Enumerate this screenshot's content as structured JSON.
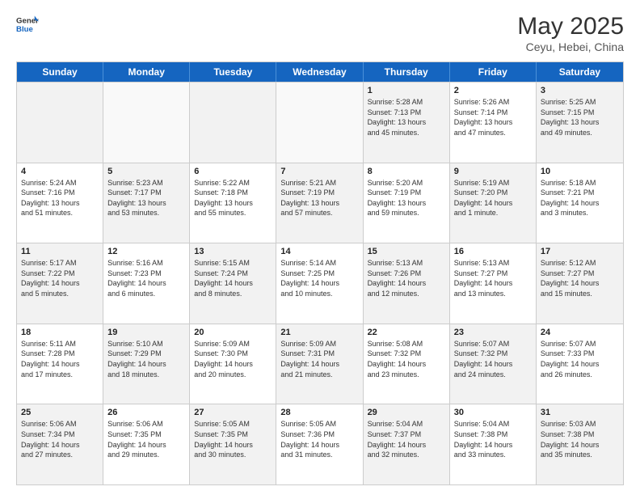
{
  "header": {
    "logo_general": "General",
    "logo_blue": "Blue",
    "title": "May 2025",
    "subtitle": "Ceyu, Hebei, China"
  },
  "days_of_week": [
    "Sunday",
    "Monday",
    "Tuesday",
    "Wednesday",
    "Thursday",
    "Friday",
    "Saturday"
  ],
  "weeks": [
    [
      {
        "day": "",
        "text": "",
        "shaded": true
      },
      {
        "day": "",
        "text": "",
        "shaded": false
      },
      {
        "day": "",
        "text": "",
        "shaded": true
      },
      {
        "day": "",
        "text": "",
        "shaded": false
      },
      {
        "day": "1",
        "text": "Sunrise: 5:28 AM\nSunset: 7:13 PM\nDaylight: 13 hours\nand 45 minutes.",
        "shaded": true
      },
      {
        "day": "2",
        "text": "Sunrise: 5:26 AM\nSunset: 7:14 PM\nDaylight: 13 hours\nand 47 minutes.",
        "shaded": false
      },
      {
        "day": "3",
        "text": "Sunrise: 5:25 AM\nSunset: 7:15 PM\nDaylight: 13 hours\nand 49 minutes.",
        "shaded": true
      }
    ],
    [
      {
        "day": "4",
        "text": "Sunrise: 5:24 AM\nSunset: 7:16 PM\nDaylight: 13 hours\nand 51 minutes.",
        "shaded": false
      },
      {
        "day": "5",
        "text": "Sunrise: 5:23 AM\nSunset: 7:17 PM\nDaylight: 13 hours\nand 53 minutes.",
        "shaded": true
      },
      {
        "day": "6",
        "text": "Sunrise: 5:22 AM\nSunset: 7:18 PM\nDaylight: 13 hours\nand 55 minutes.",
        "shaded": false
      },
      {
        "day": "7",
        "text": "Sunrise: 5:21 AM\nSunset: 7:19 PM\nDaylight: 13 hours\nand 57 minutes.",
        "shaded": true
      },
      {
        "day": "8",
        "text": "Sunrise: 5:20 AM\nSunset: 7:19 PM\nDaylight: 13 hours\nand 59 minutes.",
        "shaded": false
      },
      {
        "day": "9",
        "text": "Sunrise: 5:19 AM\nSunset: 7:20 PM\nDaylight: 14 hours\nand 1 minute.",
        "shaded": true
      },
      {
        "day": "10",
        "text": "Sunrise: 5:18 AM\nSunset: 7:21 PM\nDaylight: 14 hours\nand 3 minutes.",
        "shaded": false
      }
    ],
    [
      {
        "day": "11",
        "text": "Sunrise: 5:17 AM\nSunset: 7:22 PM\nDaylight: 14 hours\nand 5 minutes.",
        "shaded": true
      },
      {
        "day": "12",
        "text": "Sunrise: 5:16 AM\nSunset: 7:23 PM\nDaylight: 14 hours\nand 6 minutes.",
        "shaded": false
      },
      {
        "day": "13",
        "text": "Sunrise: 5:15 AM\nSunset: 7:24 PM\nDaylight: 14 hours\nand 8 minutes.",
        "shaded": true
      },
      {
        "day": "14",
        "text": "Sunrise: 5:14 AM\nSunset: 7:25 PM\nDaylight: 14 hours\nand 10 minutes.",
        "shaded": false
      },
      {
        "day": "15",
        "text": "Sunrise: 5:13 AM\nSunset: 7:26 PM\nDaylight: 14 hours\nand 12 minutes.",
        "shaded": true
      },
      {
        "day": "16",
        "text": "Sunrise: 5:13 AM\nSunset: 7:27 PM\nDaylight: 14 hours\nand 13 minutes.",
        "shaded": false
      },
      {
        "day": "17",
        "text": "Sunrise: 5:12 AM\nSunset: 7:27 PM\nDaylight: 14 hours\nand 15 minutes.",
        "shaded": true
      }
    ],
    [
      {
        "day": "18",
        "text": "Sunrise: 5:11 AM\nSunset: 7:28 PM\nDaylight: 14 hours\nand 17 minutes.",
        "shaded": false
      },
      {
        "day": "19",
        "text": "Sunrise: 5:10 AM\nSunset: 7:29 PM\nDaylight: 14 hours\nand 18 minutes.",
        "shaded": true
      },
      {
        "day": "20",
        "text": "Sunrise: 5:09 AM\nSunset: 7:30 PM\nDaylight: 14 hours\nand 20 minutes.",
        "shaded": false
      },
      {
        "day": "21",
        "text": "Sunrise: 5:09 AM\nSunset: 7:31 PM\nDaylight: 14 hours\nand 21 minutes.",
        "shaded": true
      },
      {
        "day": "22",
        "text": "Sunrise: 5:08 AM\nSunset: 7:32 PM\nDaylight: 14 hours\nand 23 minutes.",
        "shaded": false
      },
      {
        "day": "23",
        "text": "Sunrise: 5:07 AM\nSunset: 7:32 PM\nDaylight: 14 hours\nand 24 minutes.",
        "shaded": true
      },
      {
        "day": "24",
        "text": "Sunrise: 5:07 AM\nSunset: 7:33 PM\nDaylight: 14 hours\nand 26 minutes.",
        "shaded": false
      }
    ],
    [
      {
        "day": "25",
        "text": "Sunrise: 5:06 AM\nSunset: 7:34 PM\nDaylight: 14 hours\nand 27 minutes.",
        "shaded": true
      },
      {
        "day": "26",
        "text": "Sunrise: 5:06 AM\nSunset: 7:35 PM\nDaylight: 14 hours\nand 29 minutes.",
        "shaded": false
      },
      {
        "day": "27",
        "text": "Sunrise: 5:05 AM\nSunset: 7:35 PM\nDaylight: 14 hours\nand 30 minutes.",
        "shaded": true
      },
      {
        "day": "28",
        "text": "Sunrise: 5:05 AM\nSunset: 7:36 PM\nDaylight: 14 hours\nand 31 minutes.",
        "shaded": false
      },
      {
        "day": "29",
        "text": "Sunrise: 5:04 AM\nSunset: 7:37 PM\nDaylight: 14 hours\nand 32 minutes.",
        "shaded": true
      },
      {
        "day": "30",
        "text": "Sunrise: 5:04 AM\nSunset: 7:38 PM\nDaylight: 14 hours\nand 33 minutes.",
        "shaded": false
      },
      {
        "day": "31",
        "text": "Sunrise: 5:03 AM\nSunset: 7:38 PM\nDaylight: 14 hours\nand 35 minutes.",
        "shaded": true
      }
    ]
  ]
}
